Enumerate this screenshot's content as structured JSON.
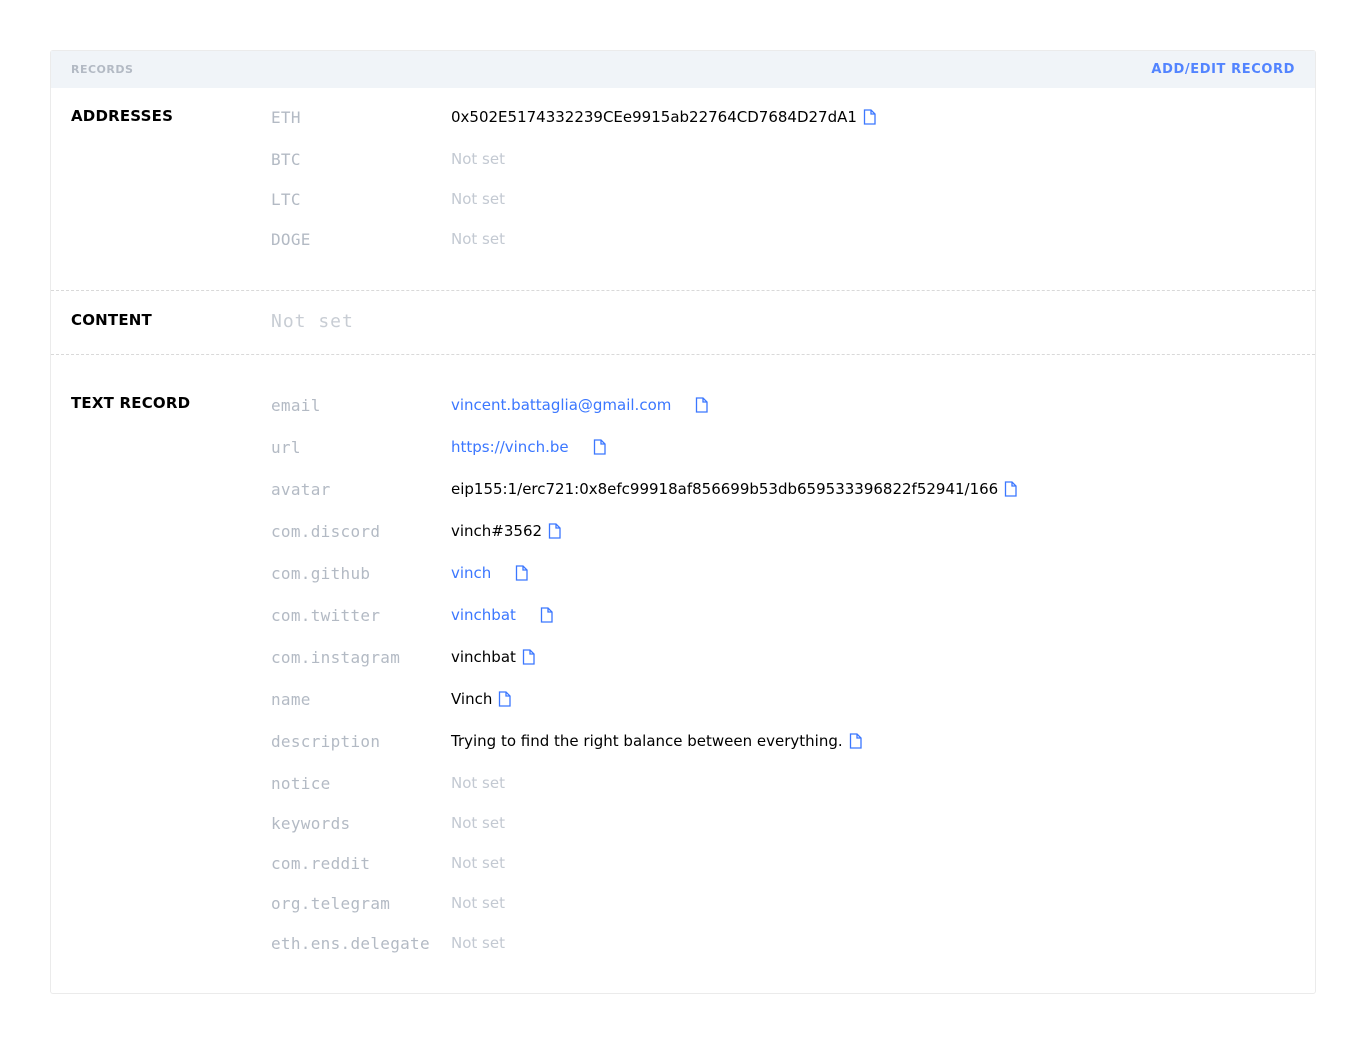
{
  "header": {
    "title": "RECORDS",
    "action": "ADD/EDIT RECORD"
  },
  "addresses": {
    "title": "ADDRESSES",
    "rows": [
      {
        "key": "ETH",
        "value": "0x502E5174332239CEe9915ab22764CD7684D27dA1"
      },
      {
        "key": "BTC",
        "value": "Not set"
      },
      {
        "key": "LTC",
        "value": "Not set"
      },
      {
        "key": "DOGE",
        "value": "Not set"
      }
    ]
  },
  "content": {
    "title": "CONTENT",
    "value": "Not set"
  },
  "text_record": {
    "title": "TEXT RECORD",
    "rows": [
      {
        "key": "email",
        "value": "vincent.battaglia@gmail.com"
      },
      {
        "key": "url",
        "value": "https://vinch.be"
      },
      {
        "key": "avatar",
        "value": "eip155:1/erc721:0x8efc99918af856699b53db659533396822f52941/166"
      },
      {
        "key": "com.discord",
        "value": "vinch#3562"
      },
      {
        "key": "com.github",
        "value": "vinch"
      },
      {
        "key": "com.twitter",
        "value": "vinchbat"
      },
      {
        "key": "com.instagram",
        "value": "vinchbat"
      },
      {
        "key": "name",
        "value": "Vinch"
      },
      {
        "key": "description",
        "value": "Trying to find the right balance between everything."
      },
      {
        "key": "notice",
        "value": "Not set"
      },
      {
        "key": "keywords",
        "value": "Not set"
      },
      {
        "key": "com.reddit",
        "value": "Not set"
      },
      {
        "key": "org.telegram",
        "value": "Not set"
      },
      {
        "key": "eth.ens.delegate",
        "value": "Not set"
      }
    ]
  },
  "icons": {
    "copy": "copy-icon"
  },
  "colors": {
    "accent": "#5284ff",
    "link": "#3b77ff",
    "muted": "#b3bac4",
    "header_bg": "#f0f4f8"
  }
}
